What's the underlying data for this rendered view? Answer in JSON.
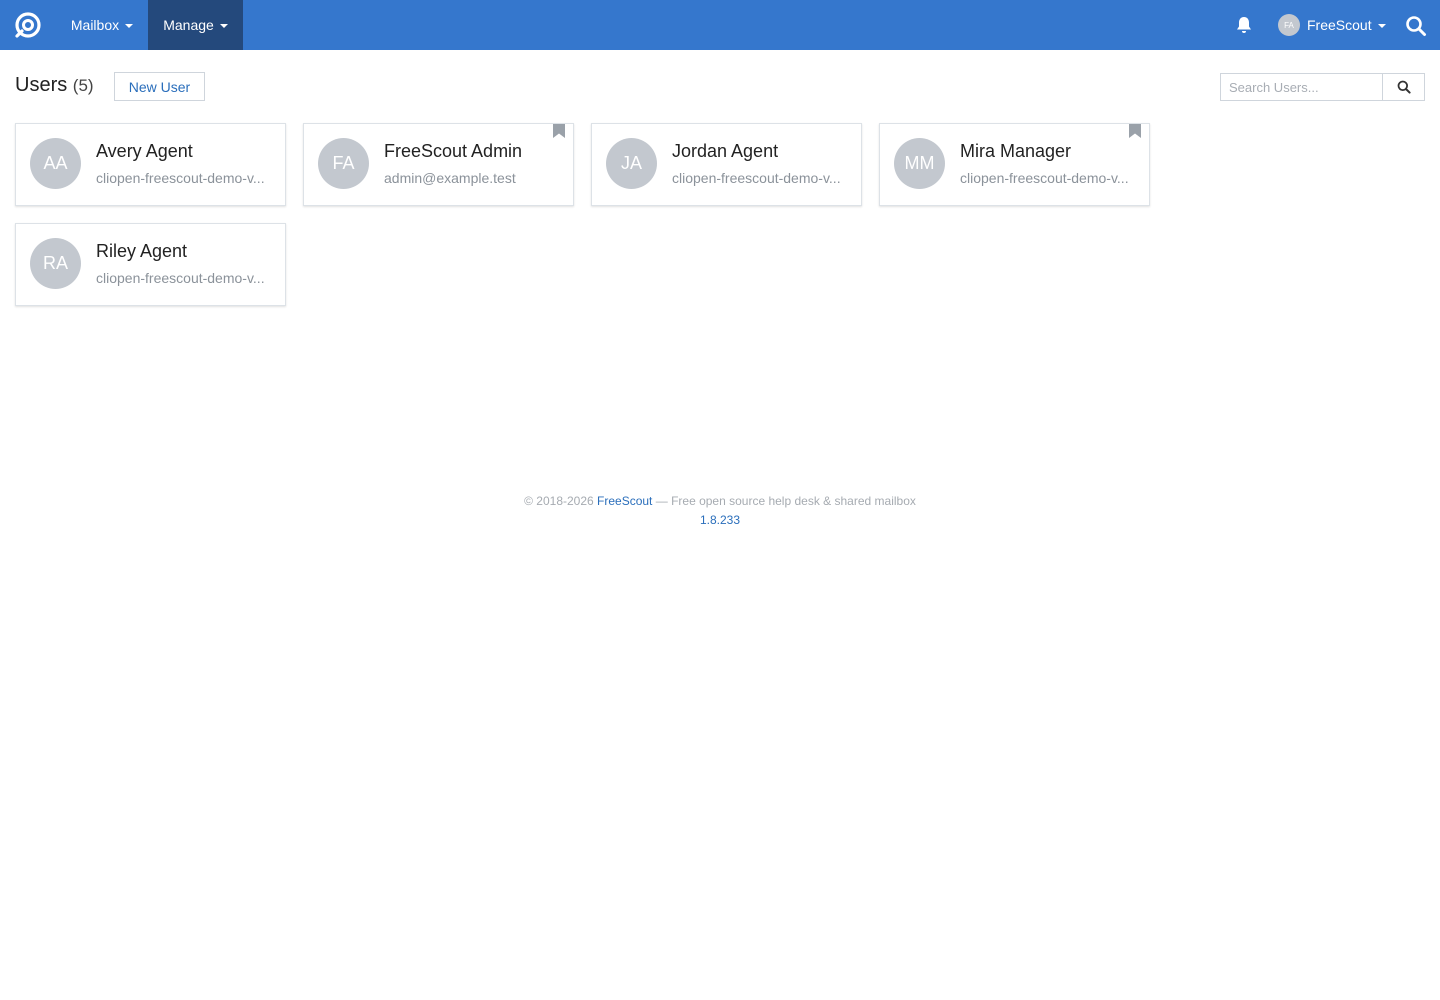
{
  "nav": {
    "mailbox_label": "Mailbox",
    "manage_label": "Manage",
    "user_initials": "FA",
    "user_name": "FreeScout",
    "brand_color": "#3577cd",
    "active_color": "#24497c"
  },
  "header": {
    "title": "Users",
    "count": "(5)",
    "new_user_label": "New User",
    "search_placeholder": "Search Users..."
  },
  "users": [
    {
      "initials": "AA",
      "name": "Avery Agent",
      "email": "cliopen-freescout-demo-v..."
    },
    {
      "initials": "FA",
      "name": "FreeScout Admin",
      "email": "admin@example.test"
    },
    {
      "initials": "JA",
      "name": "Jordan Agent",
      "email": "cliopen-freescout-demo-v..."
    },
    {
      "initials": "MM",
      "name": "Mira Manager",
      "email": "cliopen-freescout-demo-v..."
    },
    {
      "initials": "RA",
      "name": "Riley Agent",
      "email": "cliopen-freescout-demo-v..."
    }
  ],
  "footer": {
    "copyright": "© 2018-2026",
    "brand": "FreeScout",
    "tagline": "— Free open source help desk & shared mailbox",
    "version": "1.8.233"
  }
}
